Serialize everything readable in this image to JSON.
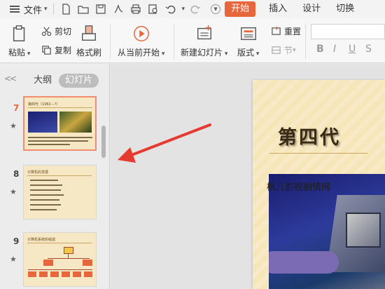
{
  "menubar": {
    "file_label": "文件",
    "tabs": [
      "开始",
      "插入",
      "设计",
      "切换"
    ],
    "active_tab": "开始"
  },
  "ribbon": {
    "paste": "粘贴",
    "cut": "剪切",
    "copy": "复制",
    "format_painter": "格式刷",
    "play_from_current": "从当前开始",
    "new_slide": "新建幻灯片",
    "layout": "版式",
    "section": "节",
    "reset": "重置",
    "format_buttons": [
      "B",
      "I",
      "U",
      "S"
    ]
  },
  "left_panel": {
    "tab_outline": "大纲",
    "tab_slides": "幻灯片",
    "slides": [
      {
        "number": "7",
        "title": "第四代（1982—?）"
      },
      {
        "number": "8",
        "title": "计算机的发展"
      },
      {
        "number": "9",
        "title": "计算机系统的组成"
      }
    ]
  },
  "slide": {
    "title": "第四代",
    "watermark": "枫儿影视剧情网"
  },
  "colors": {
    "accent": "#e8663c",
    "slide_bg": "#f7e6b9",
    "arrow": "#e53a2f"
  }
}
